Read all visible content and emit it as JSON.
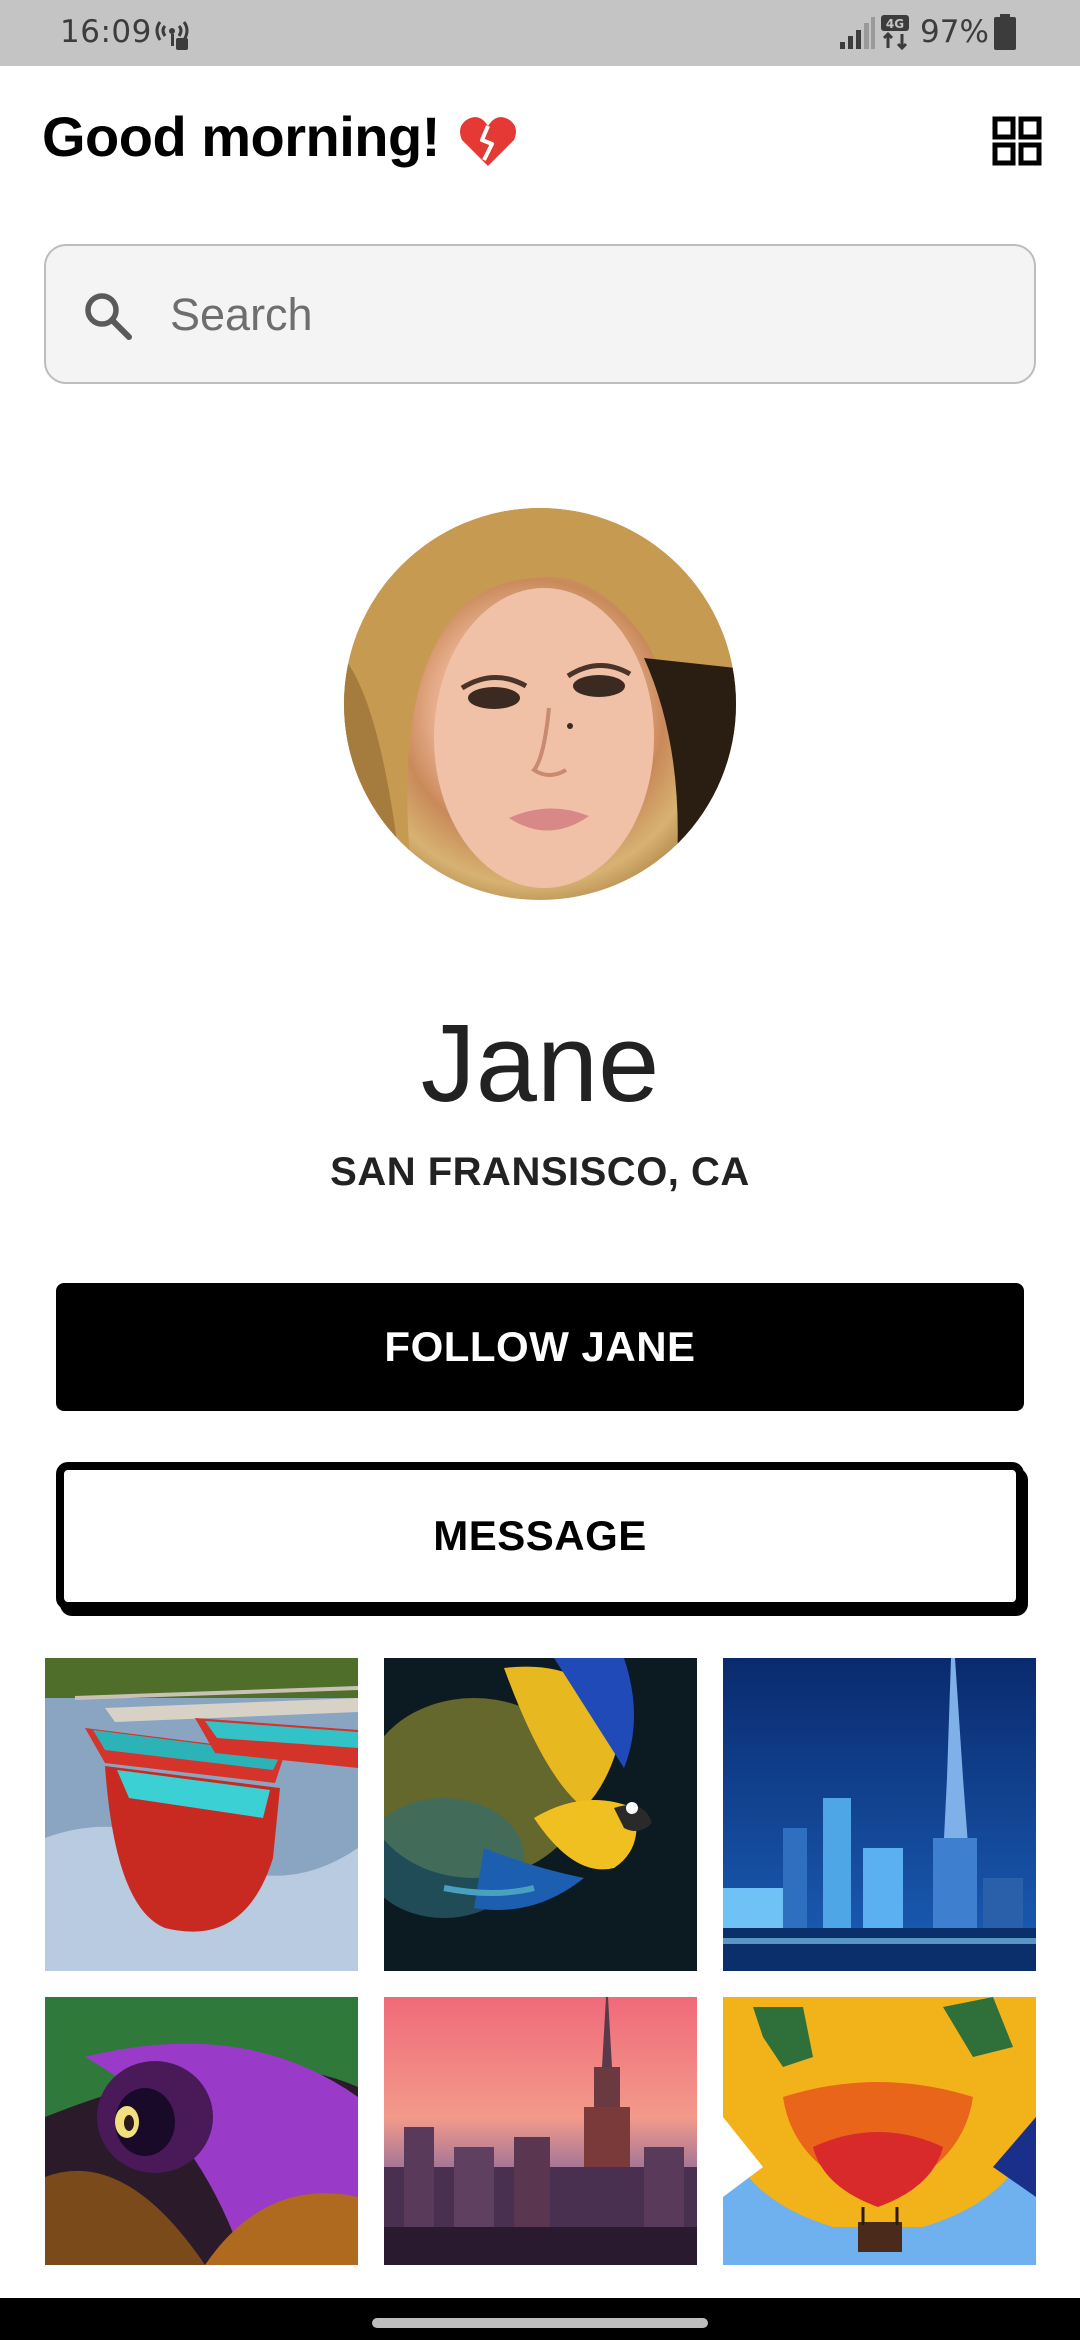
{
  "status_bar": {
    "time": "16:09",
    "battery": "97%",
    "network_badge": "4G",
    "icons": [
      "hotspot-icon",
      "signal-icon",
      "network-4g-icon",
      "battery-icon"
    ]
  },
  "header": {
    "greeting": "Good morning!",
    "mood_icon": "broken-heart-icon",
    "menu_icon": "grid-view-icon"
  },
  "search": {
    "value": "",
    "placeholder": "Search"
  },
  "profile": {
    "name": "Jane",
    "location": "SAN FRANSISCO, CA",
    "avatar_alt": "avatar"
  },
  "actions": {
    "follow_label": "FOLLOW JANE",
    "message_label": "MESSAGE"
  },
  "gallery": {
    "photos": [
      {
        "subject": "red rowboats on a lake"
      },
      {
        "subject": "macaw in flight with yellow dust"
      },
      {
        "subject": "city skyline at night with tall tower"
      },
      {
        "subject": "peacock feather with water droplet"
      },
      {
        "subject": "city skyline at sunset"
      },
      {
        "subject": "hot air balloon"
      }
    ]
  },
  "colors": {
    "status_bar_bg": "#c4c4c4",
    "primary": "#000000",
    "accent_heart": "#e53935",
    "search_bg": "#f4f4f4"
  }
}
